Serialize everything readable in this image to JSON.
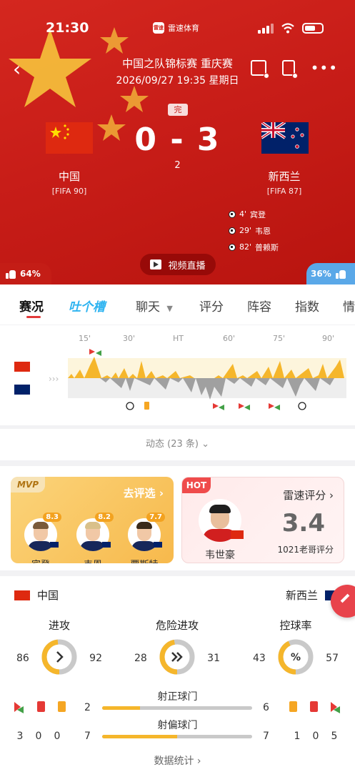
{
  "status_bar": {
    "time": "21:30",
    "app_name": "雷速体育",
    "app_logo": "雷速"
  },
  "header": {
    "competition": "中国之队锦标赛 重庆赛",
    "datetime": "2026/09/27 19:35 星期日",
    "status": "完",
    "score": "0 - 3",
    "score_sub": "2"
  },
  "home": {
    "name": "中国",
    "rank": "[FIFA 90]",
    "vote": "64%"
  },
  "away": {
    "name": "新西兰",
    "rank": "[FIFA 87]",
    "vote": "36%"
  },
  "goals": [
    {
      "minute": "4'",
      "player": "宾登"
    },
    {
      "minute": "29'",
      "player": "韦恩"
    },
    {
      "minute": "82'",
      "player": "普赖斯"
    }
  ],
  "live_button": "视频直播",
  "tabs": [
    "赛况",
    "吐个槽",
    "聊天",
    "评分",
    "阵容",
    "指数",
    "情"
  ],
  "timeline": {
    "ticks": [
      "15'",
      "30'",
      "HT",
      "60'",
      "75'",
      "90'"
    ]
  },
  "events_link": "动态 (23 条)",
  "mvp": {
    "tag": "MVP",
    "action": "去评选 ›",
    "players": [
      {
        "name": "宾登",
        "rating": "8.3"
      },
      {
        "name": "韦恩",
        "rating": "8.2"
      },
      {
        "name": "贾斯特",
        "rating": "7.7"
      }
    ]
  },
  "hot": {
    "tag": "HOT",
    "player": "韦世豪",
    "title": "雷速评分 ›",
    "rating": "3.4",
    "count": "1021老哥评分"
  },
  "stats": {
    "home_name": "中国",
    "away_name": "新西兰",
    "gauges": [
      {
        "title": "进攻",
        "home": "86",
        "away": "92",
        "icon": "chevron-right-icon"
      },
      {
        "title": "危险进攻",
        "home": "28",
        "away": "31",
        "icon": "double-chevron-icon"
      },
      {
        "title": "控球率",
        "home": "43",
        "away": "57",
        "icon": "percent-icon"
      }
    ],
    "bars": [
      {
        "label": "射正球门",
        "home": "2",
        "away": "6",
        "home_share": 0.25
      },
      {
        "label": "射偏球门",
        "home": "7",
        "away": "7",
        "home_share": 0.5
      }
    ],
    "home_counts": [
      "3",
      "0",
      "0"
    ],
    "away_counts": [
      "1",
      "0",
      "5"
    ],
    "link": "数据统计 ›"
  },
  "colors": {
    "primary_red": "#d4271f",
    "accent_yellow": "#f5b62b",
    "away_blue": "#5aa8e8"
  }
}
